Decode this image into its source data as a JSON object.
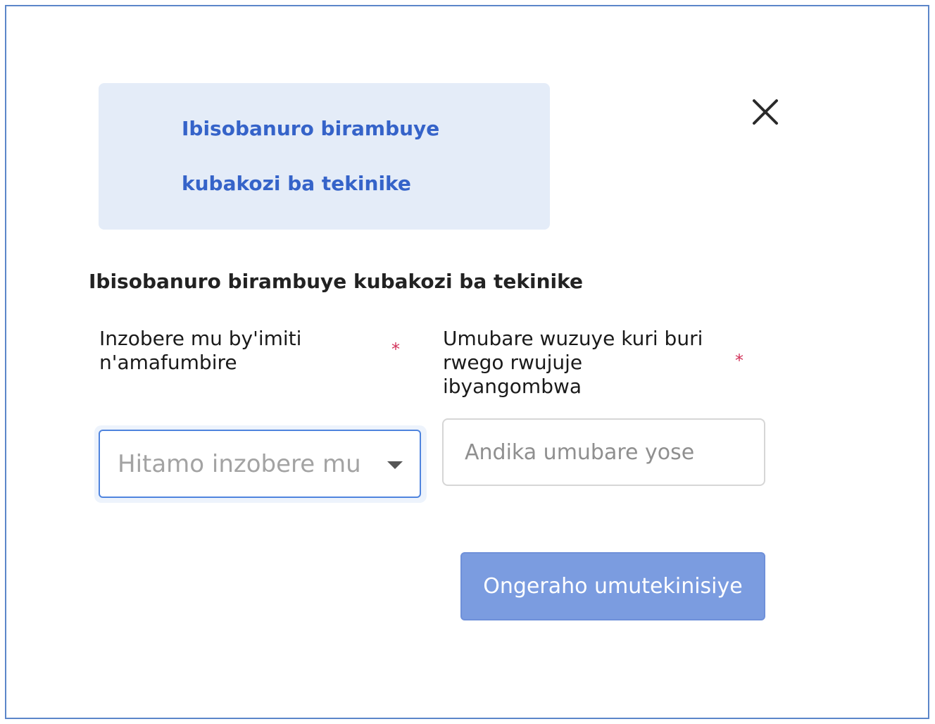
{
  "banner": {
    "line1": "Ibisobanuro birambuye",
    "line2": "kubakozi ba tekinike"
  },
  "close": {
    "icon": "close-icon"
  },
  "section_title": "Ibisobanuro birambuye kubakozi ba tekinike",
  "fields": {
    "expertise": {
      "label": "Inzobere mu by'imiti n'amafumbire",
      "required_mark": "*",
      "placeholder": "Hitamo inzobere mu by'imiti",
      "icon": "chevron-down-icon"
    },
    "count": {
      "label": "Umubare wuzuye kuri buri rwego rwujuje ibyangombwa",
      "required_mark": "*",
      "placeholder": "Andika umubare yose"
    }
  },
  "submit_label": "Ongeraho umutekinisiye",
  "colors": {
    "accent": "#3563c9",
    "banner_bg": "#e4ecf8",
    "button_bg": "#7b9ce0",
    "required": "#d2335a",
    "focus_border": "#4f84de"
  }
}
